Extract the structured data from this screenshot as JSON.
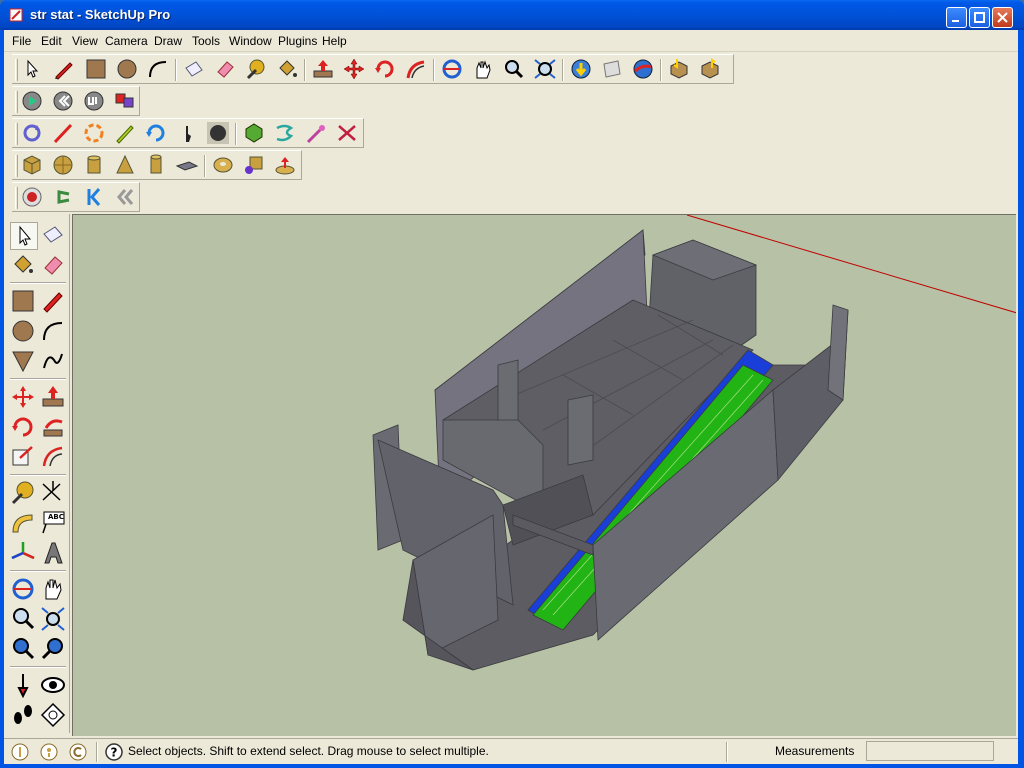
{
  "window": {
    "title": "str stat - SketchUp Pro"
  },
  "menu": [
    "File",
    "Edit",
    "View",
    "Camera",
    "Draw",
    "Tools",
    "Window",
    "Plugins",
    "Help"
  ],
  "toolbars": {
    "getting_started": [
      "select-icon",
      "pencil-icon",
      "rectangle-icon",
      "circle-icon",
      "arc-icon",
      "eraser-page-icon",
      "eraser-icon",
      "tape-measure-icon",
      "paint-bucket-icon",
      "push-pull-icon",
      "move-icon",
      "rotate-icon",
      "follow-me-icon",
      "orbit-icon",
      "pan-icon",
      "zoom-icon",
      "zoom-extents-icon",
      "get-models-icon",
      "share-model-icon",
      "google-earth-icon",
      "get-component-icon",
      "share-component-icon"
    ],
    "plugins_row": [
      "play-icon",
      "rewind-icon",
      "ui-icon",
      "component-icon"
    ],
    "edit_row": [
      "rotate-arrows-icon",
      "line-icon",
      "dashed-circle-icon",
      "pencil-green-icon",
      "refresh-icon",
      "hand-icon",
      "dark-circle-icon",
      "leaf-icon",
      "wave-icon",
      "wand-icon",
      "close-x-icon"
    ],
    "shapes_row": [
      "box-icon",
      "sphere-icon",
      "cylinder-icon",
      "cone-icon",
      "tube-icon",
      "plate-icon",
      "donut-icon",
      "shapes-icon",
      "upload-icon"
    ],
    "record_row": [
      "record-icon",
      "undo-arrow-icon",
      "first-icon",
      "back-icon"
    ]
  },
  "left_toolbar": [
    "select-icon",
    "eraser-page-icon",
    "paint-bucket-icon",
    "eraser-icon",
    "rectangle-icon",
    "pencil-icon",
    "circle-icon",
    "arc-icon",
    "polygon-icon",
    "freehand-icon",
    "move-icon",
    "push-pull-icon",
    "rotate-icon",
    "follow-me-icon",
    "scale-icon",
    "offset-icon",
    "tape-measure-icon",
    "dimension-icon",
    "protractor-icon",
    "text-icon",
    "axes-icon",
    "3d-text-icon",
    "orbit-icon",
    "pan-icon",
    "zoom-icon",
    "zoom-window-icon",
    "previous-icon",
    "next-icon",
    "position-camera-icon",
    "look-around-icon",
    "walk-icon",
    "section-plane-icon"
  ],
  "text_tool_label": "ABC",
  "status": {
    "message": "Select objects. Shift to extend select. Drag mouse to select multiple.",
    "measurements_label": "Measurements",
    "measurements_value": ""
  },
  "colors": {
    "viewport": "#b6c1a5",
    "ui": "#ece9d8",
    "titlebar": "#0055e5",
    "model_wall": "#6e6e76",
    "model_floor": "#5c5c62",
    "channel_blue": "#1a3fd8",
    "channel_green": "#22b314",
    "axis_red": "#c00000"
  }
}
